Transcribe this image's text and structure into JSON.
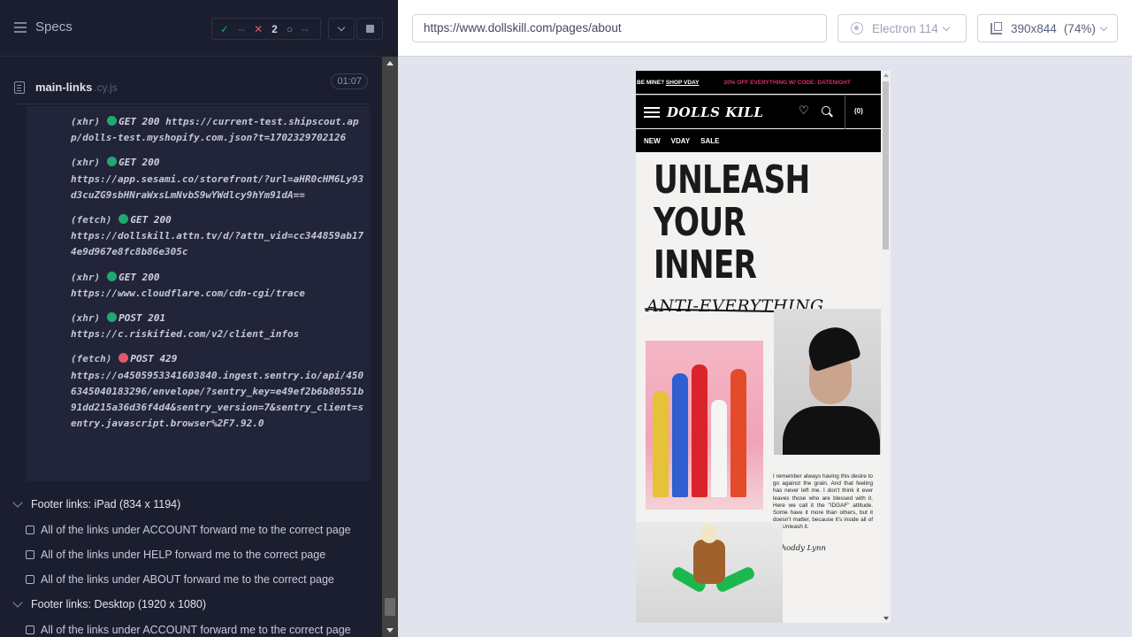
{
  "sidebar": {
    "title": "Specs",
    "stats": {
      "passed": "--",
      "failed": "2",
      "pending": "--"
    }
  },
  "spec": {
    "name": "main-links",
    "ext": ".cy.js",
    "duration": "01:07"
  },
  "logs": [
    {
      "type": "(xhr)",
      "status": "ok",
      "method": "GET 200",
      "url": "https://current-test.shipscout.app/dolls-test.myshopify.com.json?t=1702329702126"
    },
    {
      "type": "(xhr)",
      "status": "ok",
      "method": "GET 200",
      "url": "https://app.sesami.co/storefront/?url=aHR0cHM6Ly93d3cuZG9sbHNraWxsLmNvbS9wYWdlcy9hYm91dA=="
    },
    {
      "type": "(fetch)",
      "status": "ok",
      "method": "GET 200",
      "url": "https://dollskill.attn.tv/d/?attn_vid=cc344859ab174e9d967e8fc8b86e305c"
    },
    {
      "type": "(xhr)",
      "status": "ok",
      "method": "GET 200",
      "url": "https://www.cloudflare.com/cdn-cgi/trace"
    },
    {
      "type": "(xhr)",
      "status": "ok",
      "method": "POST 201",
      "url": "https://c.riskified.com/v2/client_infos"
    },
    {
      "type": "(fetch)",
      "status": "err",
      "method": "POST 429",
      "url": "https://o4505953341603840.ingest.sentry.io/api/4506345040183296/envelope/?sentry_key=e49ef2b6b80551b91dd215a36d36f4d4&sentry_version=7&sentry_client=sentry.javascript.browser%2F7.92.0"
    }
  ],
  "suites": [
    {
      "label": "Footer links: iPad (834 x 1194)"
    },
    {
      "label": "Footer links: Desktop (1920 x 1080)"
    }
  ],
  "tests": [
    "All of the links under ACCOUNT forward me to the correct page",
    "All of the links under HELP forward me to the correct page",
    "All of the links under ABOUT forward me to the correct page",
    "All of the links under ACCOUNT forward me to the correct page"
  ],
  "toolbar": {
    "url": "https://www.dollskill.com/pages/about",
    "browser": "Electron 114",
    "viewport": "390x844",
    "zoom": "(74%)"
  },
  "aut": {
    "promo_left": "BE MINE?",
    "promo_link": "SHOP VDAY",
    "promo_right": "20% OFF EVERYTHING W/ CODE: DATENIGHT",
    "logo": "DOLLS KILL",
    "cart": "(0)",
    "nav": [
      "NEW",
      "VDAY",
      "SALE"
    ],
    "hero": [
      "UNLEASH",
      "YOUR",
      "INNER"
    ],
    "script": "ANTI-EVERYTHING.",
    "quote": "I remember always having this desire to go against the grain. And that feeling has never left me. I don't think it ever leaves those who are blessed with it. Here we call it the \"IDGAF\" attitude. Some have it more than others, but it doesn't matter, because it's inside all of us. Unleash it.",
    "signature": "-Shoddy Lynn"
  },
  "colors": {
    "pass": "#1fa971",
    "fail": "#e45770",
    "accent_pink": "#e02a6c"
  }
}
